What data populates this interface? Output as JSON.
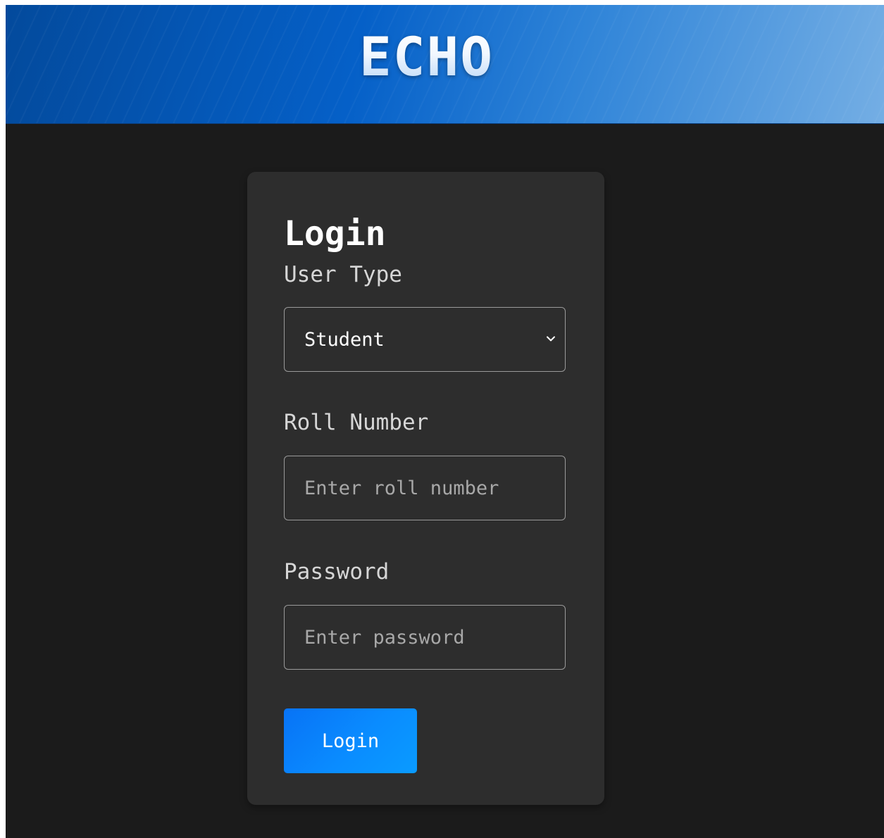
{
  "header": {
    "brand": "ECHO"
  },
  "login_form": {
    "title": "Login",
    "user_type": {
      "label": "User Type",
      "selected": "Student",
      "icon": "chevron-down-icon"
    },
    "roll_number": {
      "label": "Roll Number",
      "placeholder": "Enter roll number",
      "value": ""
    },
    "password": {
      "label": "Password",
      "placeholder": "Enter password",
      "value": ""
    },
    "submit_label": "Login"
  },
  "colors": {
    "background": "#1b1b1b",
    "card": "#2d2d2d",
    "header_start": "#034a9c",
    "header_end": "#74aee4",
    "button": "#0a8cff",
    "text": "#ffffff",
    "label_text": "#d6d6d6",
    "placeholder": "#a8a8a8"
  }
}
